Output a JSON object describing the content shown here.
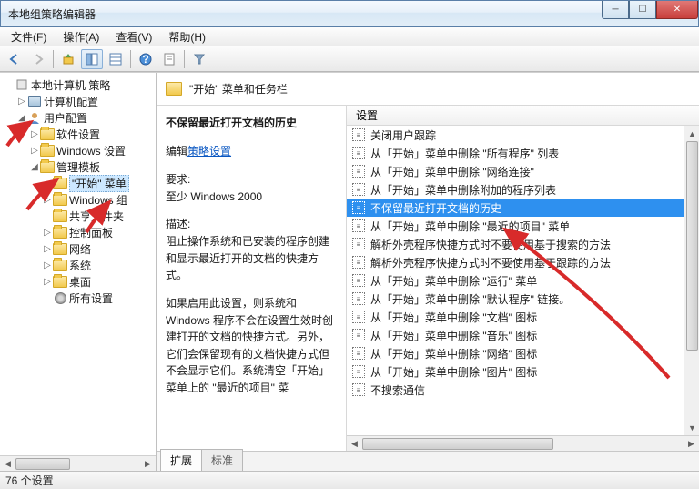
{
  "window": {
    "title": "本地组策略编辑器"
  },
  "menu": {
    "file": "文件(F)",
    "action": "操作(A)",
    "view": "查看(V)",
    "help": "帮助(H)"
  },
  "tree": {
    "root": "本地计算机 策略",
    "computer": "计算机配置",
    "user": "用户配置",
    "software": "软件设置",
    "windows": "Windows 设置",
    "admin": "管理模板",
    "start": "\"开始\" 菜单",
    "wincomp": "Windows 组",
    "shared": "共享文件夹",
    "control": "控制面板",
    "network": "网络",
    "system": "系统",
    "desktop": "桌面",
    "allset": "所有设置"
  },
  "header": {
    "title": "\"开始\" 菜单和任务栏"
  },
  "list_header": "设置",
  "description": {
    "title": "不保留最近打开文档的历史",
    "edit_label": "编辑",
    "edit_link": "策略设置",
    "req_label": "要求:",
    "req_text": "至少 Windows 2000",
    "desc_label": "描述:",
    "desc_p1": "阻止操作系统和已安装的程序创建和显示最近打开的文档的快捷方式。",
    "desc_p2": "如果启用此设置，则系统和 Windows 程序不会在设置生效时创建打开的文档的快捷方式。另外，它们会保留现有的文档快捷方式但不会显示它们。系统清空「开始」菜单上的 \"最近的项目\" 菜"
  },
  "settings": [
    "关闭用户跟踪",
    "从「开始」菜单中删除 \"所有程序\" 列表",
    "从「开始」菜单中删除 \"网络连接\"",
    "从「开始」菜单中删除附加的程序列表",
    "不保留最近打开文档的历史",
    "从「开始」菜单中删除 \"最近的项目\" 菜单",
    "解析外壳程序快捷方式时不要使用基于搜索的方法",
    "解析外壳程序快捷方式时不要使用基于跟踪的方法",
    "从「开始」菜单中删除 \"运行\" 菜单",
    "从「开始」菜单中删除 \"默认程序\" 链接。",
    "从「开始」菜单中删除 \"文档\" 图标",
    "从「开始」菜单中删除 \"音乐\" 图标",
    "从「开始」菜单中删除 \"网络\" 图标",
    "从「开始」菜单中删除 \"图片\" 图标",
    "不搜索通信"
  ],
  "selected_index": 4,
  "tabs": {
    "extended": "扩展",
    "standard": "标准"
  },
  "status": "76 个设置"
}
